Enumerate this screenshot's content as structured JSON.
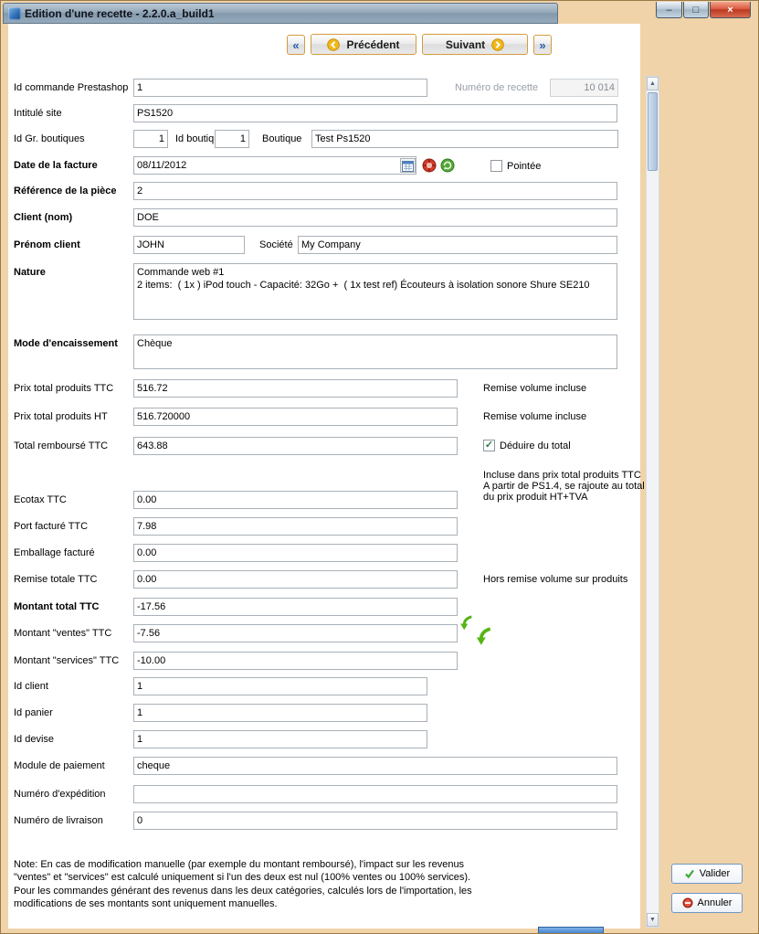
{
  "window": {
    "title": "Edition d'une recette - 2.2.0.a_build1"
  },
  "icons": {
    "minimize": "–",
    "maximize": "□",
    "close": "×",
    "nav_first": "«",
    "nav_last": "»",
    "up": "▲",
    "down": "▼"
  },
  "nav": {
    "prev": "Précédent",
    "next": "Suivant"
  },
  "fields": {
    "id_commande": {
      "label": "Id commande Prestashop",
      "value": "1"
    },
    "numero_recette": {
      "label": "Numéro de recette",
      "value": "10 014"
    },
    "intitule_site": {
      "label": "Intitulé site",
      "value": "PS1520"
    },
    "id_gr_boutiques": {
      "label": "Id Gr. boutiques",
      "value": "1"
    },
    "id_boutique": {
      "label": "Id boutique",
      "value": "1"
    },
    "boutique": {
      "label": "Boutique",
      "value": "Test Ps1520"
    },
    "date_facture": {
      "label": "Date de la facture",
      "value": "08/11/2012"
    },
    "pointee": {
      "label": "Pointée"
    },
    "reference_piece": {
      "label": "Référence de la pièce",
      "value": "2"
    },
    "client_nom": {
      "label": "Client (nom)",
      "value": "DOE"
    },
    "prenom_client": {
      "label": "Prénom client",
      "value": "JOHN"
    },
    "societe": {
      "label": "Société",
      "value": "My Company"
    },
    "nature": {
      "label": "Nature",
      "value": "Commande web #1\n2 items:  ( 1x ) iPod touch - Capacité: 32Go +  ( 1x test ref) Écouteurs à isolation sonore Shure SE210"
    },
    "mode_encaissement": {
      "label": "Mode d'encaissement",
      "value": "Chèque"
    },
    "prix_ttc": {
      "label": "Prix total produits TTC",
      "value": "516.72",
      "note": "Remise volume incluse"
    },
    "prix_ht": {
      "label": "Prix total produits HT",
      "value": "516.720000",
      "note": "Remise volume incluse"
    },
    "total_rembourse": {
      "label": "Total remboursé TTC",
      "value": "643.88"
    },
    "deduire": {
      "label": "Déduire du total",
      "checked": "✓"
    },
    "ecotax_info": "Incluse dans prix total produits TTC\nA partir de PS1.4, se rajoute au total\ndu prix produit HT+TVA",
    "ecotax": {
      "label": "Ecotax TTC",
      "value": "0.00"
    },
    "port": {
      "label": "Port facturé TTC",
      "value": "7.98"
    },
    "emballage": {
      "label": "Emballage facturé",
      "value": "0.00"
    },
    "remise": {
      "label": "Remise totale TTC",
      "value": "0.00",
      "note": "Hors remise volume sur produits"
    },
    "montant_total": {
      "label": "Montant total TTC",
      "value": "-17.56"
    },
    "montant_ventes": {
      "label": "Montant \"ventes\" TTC",
      "value": "-7.56"
    },
    "montant_services": {
      "label": "Montant \"services\" TTC",
      "value": "-10.00"
    },
    "id_client": {
      "label": "Id client",
      "value": "1"
    },
    "id_panier": {
      "label": "Id panier",
      "value": "1"
    },
    "id_devise": {
      "label": "Id devise",
      "value": "1"
    },
    "module_paiement": {
      "label": "Module de paiement",
      "value": "cheque"
    },
    "numero_expedition": {
      "label": "Numéro d'expédition",
      "value": ""
    },
    "numero_livraison": {
      "label": "Numéro de livraison",
      "value": "0"
    }
  },
  "note": "Note: En cas de modification manuelle (par exemple du montant remboursé), l'impact sur les revenus \"ventes\" et \"services\" est calculé uniquement si l'un des deux est nul (100% ventes ou 100% services). Pour les commandes générant des revenus dans les deux catégories, calculés lors de l'importation, les modifications de ses montants sont uniquement manuelles.",
  "actions": {
    "valider": "Valider",
    "annuler": "Annuler"
  }
}
